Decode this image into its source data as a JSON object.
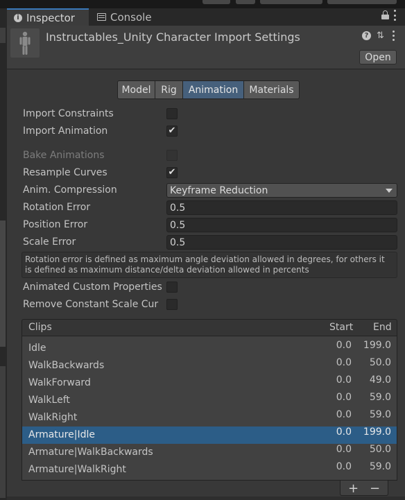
{
  "tabs": {
    "inspector": "Inspector",
    "console": "Console"
  },
  "header": {
    "title": "Instructables_Unity Character Import Settings",
    "open_label": "Open"
  },
  "section_tabs": [
    "Model",
    "Rig",
    "Animation",
    "Materials"
  ],
  "selected_section": "Animation",
  "properties": {
    "import_constraints": {
      "label": "Import Constraints",
      "checked": false
    },
    "import_animation": {
      "label": "Import Animation",
      "checked": true
    },
    "bake_animations": {
      "label": "Bake Animations",
      "checked": false,
      "disabled": true
    },
    "resample_curves": {
      "label": "Resample Curves",
      "checked": true
    },
    "anim_compression": {
      "label": "Anim. Compression",
      "value": "Keyframe Reduction"
    },
    "rotation_error": {
      "label": "Rotation Error",
      "value": "0.5"
    },
    "position_error": {
      "label": "Position Error",
      "value": "0.5"
    },
    "scale_error": {
      "label": "Scale Error",
      "value": "0.5"
    },
    "help_text": "Rotation error is defined as maximum angle deviation allowed in degrees, for others it is defined as maximum distance/delta deviation allowed in percents",
    "animated_custom_properties": {
      "label": "Animated Custom Properties",
      "checked": false
    },
    "remove_constant_scale": {
      "label": "Remove Constant Scale Cur",
      "checked": false
    }
  },
  "clips": {
    "header": {
      "name": "Clips",
      "start": "Start",
      "end": "End"
    },
    "rows": [
      {
        "name": "Idle",
        "start": "0.0",
        "end": "199.0"
      },
      {
        "name": "WalkBackwards",
        "start": "0.0",
        "end": "50.0"
      },
      {
        "name": "WalkForward",
        "start": "0.0",
        "end": "49.0"
      },
      {
        "name": "WalkLeft",
        "start": "0.0",
        "end": "59.0"
      },
      {
        "name": "WalkRight",
        "start": "0.0",
        "end": "59.0"
      },
      {
        "name": "Armature|Idle",
        "start": "0.0",
        "end": "199.0"
      },
      {
        "name": "Armature|WalkBackwards",
        "start": "0.0",
        "end": "50.0"
      },
      {
        "name": "Armature|WalkRight",
        "start": "0.0",
        "end": "59.0"
      }
    ],
    "selected_row": "Armature|Idle",
    "add_label": "+",
    "remove_label": "−"
  },
  "icons": {
    "inspector_tab": "info-icon",
    "console_tab": "console-icon",
    "lock": "lock-icon",
    "help": "help-icon",
    "preset": "preset-icon",
    "menu": "kebab-menu-icon"
  },
  "colors": {
    "background": "#383838",
    "accent_tab": "#3a79bb",
    "selected_section": "#46607c",
    "selected_row": "#2c5d87"
  }
}
